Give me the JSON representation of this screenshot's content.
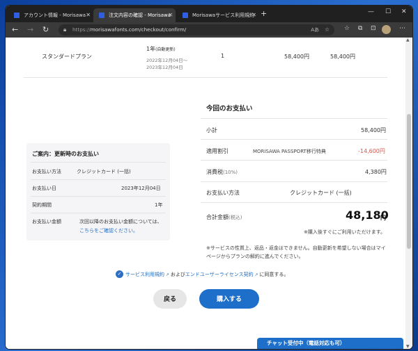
{
  "browser": {
    "tabs": [
      {
        "title": "アカウント情報 - Morisawa ID"
      },
      {
        "title": "注文内容の確認 - Morisawa Fonts"
      },
      {
        "title": "Morisawaサービス利用規約 - Moris"
      }
    ],
    "url_prefix": "https://",
    "url_main": "morisawafonts.com/checkout/confirm/",
    "zoom_label": "Aあ"
  },
  "order_row": {
    "plan": "スタンダードプラン",
    "period": "1年",
    "period_note": "(自動更新)",
    "date_from": "2022年12月04日〜",
    "date_to": "2023年12月04日",
    "quantity": "1",
    "unit_price": "58,400円",
    "total": "58,400円"
  },
  "renewal": {
    "title": "ご案内：更新時のお支払い",
    "method_label": "お支払い方法",
    "method_value": "クレジットカード (一括)",
    "date_label": "お支払い日",
    "date_value": "2023年12月04日",
    "contract_label": "契約期間",
    "contract_value": "1年",
    "amount_label": "お支払い金額",
    "amount_value": "次回以降のお支払い金額については、",
    "amount_link": "こちらをご確認ください。"
  },
  "payment": {
    "title": "今回のお支払い",
    "subtotal_label": "小計",
    "subtotal_value": "58,400円",
    "discount_label": "適用割引",
    "discount_name": "MORISAWA PASSPORT移行特典",
    "discount_value": "-14,600円",
    "tax_label": "消費税",
    "tax_rate": "(10%)",
    "tax_value": "4,380円",
    "method_label": "お支払い方法",
    "method_value": "クレジットカード (一括)",
    "total_label": "合計金額",
    "total_tax_note": "(税込)",
    "total_value": "48,180",
    "total_unit": "円",
    "usable_note": "※購入後すぐにご利用いただけます。",
    "notice_line1": "※サービスの性質上、返品・返金はできません。自動更新を希望しない場合はマイ",
    "notice_line2": "ページからプランの解約に進んでください。"
  },
  "agreement": {
    "terms_link": "サービス利用規約",
    "and": "および",
    "eula_link": "エンドユーザーライセンス契約",
    "suffix": "に同意する。"
  },
  "buttons": {
    "back": "戻る",
    "buy": "購入する"
  },
  "chat": {
    "label": "チャット受付中（電話対応も可）"
  },
  "colors": {
    "accent": "#1e6fc9",
    "discount": "#e0534a"
  }
}
